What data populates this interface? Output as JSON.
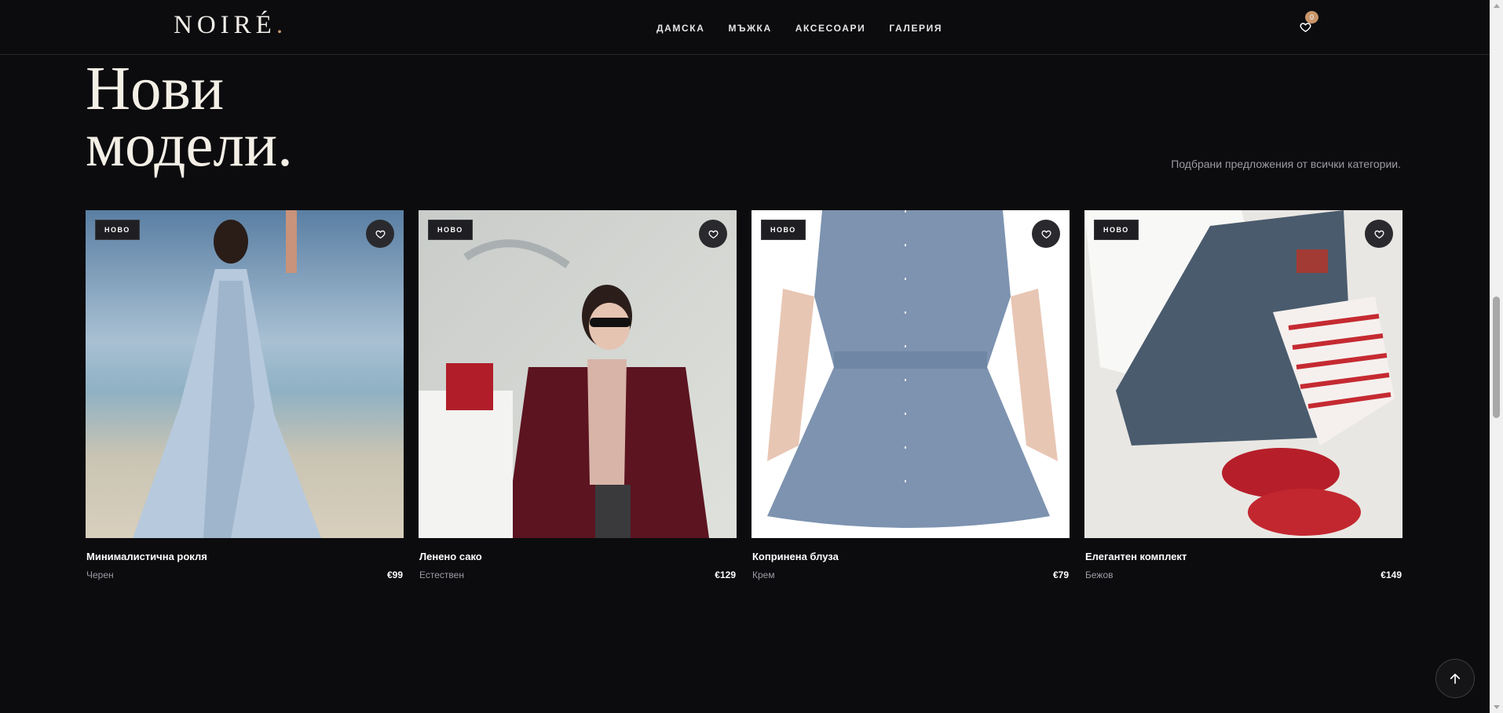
{
  "header": {
    "logo": "NOIRÉ",
    "logo_dot": ".",
    "nav": [
      "ДАМСКА",
      "МЪЖКА",
      "АКСЕСОАРИ",
      "ГАЛЕРИЯ"
    ],
    "wishlist_count": "0",
    "wishlist_icon": "heart-icon"
  },
  "section": {
    "title_line1": "Нови",
    "title_line2": "модели.",
    "subtitle": "Подбрани предложения от всички категории."
  },
  "products": [
    {
      "tag": "НОВО",
      "name": "Минималистична рокля",
      "color": "Черен",
      "price": "€99"
    },
    {
      "tag": "НОВО",
      "name": "Ленено сако",
      "color": "Естествен",
      "price": "€129"
    },
    {
      "tag": "НОВО",
      "name": "Копринена блуза",
      "color": "Крем",
      "price": "€79"
    },
    {
      "tag": "НОВО",
      "name": "Елегантен комплект",
      "color": "Бежов",
      "price": "€149"
    }
  ],
  "colors": {
    "background": "#0c0c0f",
    "accent": "#c8956a",
    "heading": "#f4efe6",
    "muted": "#9b9ba3"
  },
  "back_to_top_icon": "arrow-up-icon"
}
